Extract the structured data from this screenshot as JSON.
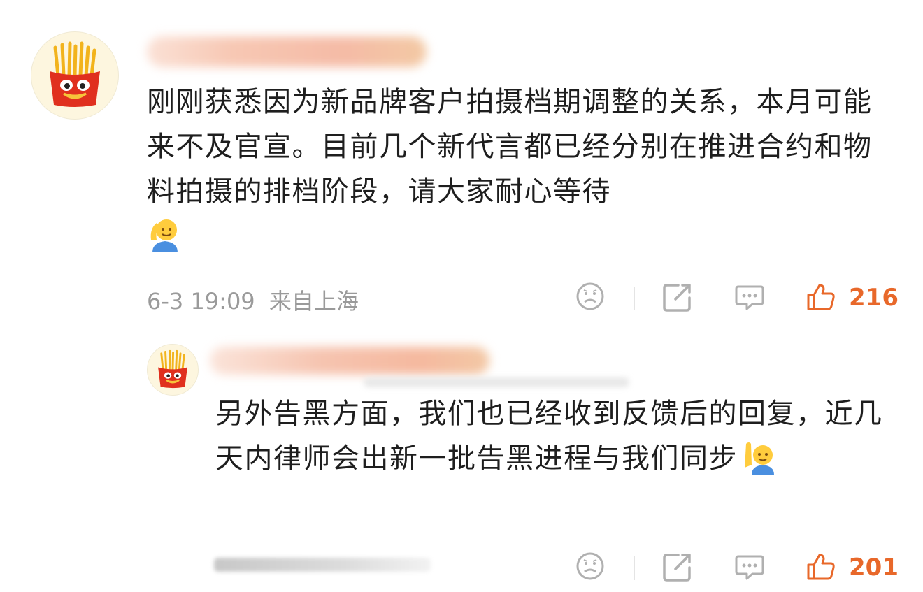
{
  "comment": {
    "author_name": "",
    "avatar_icon": "french-fries-icon",
    "text": "刚刚获悉因为新品牌客户拍摄档期调整的关系，本月可能来不及官宣。目前几个新代言都已经分别在推进合约和物料拍摄的排档阶段，请大家耐心等待",
    "emoji": "salute-emoji",
    "time": "6-3 19:09",
    "location": "来自上海",
    "likes": "216"
  },
  "reply": {
    "author_name": "",
    "avatar_icon": "french-fries-icon",
    "text": "另外告黑方面，我们也已经收到反馈后的回复，近几天内律师会出新一批告黑进程与我们同步",
    "emoji": "raise-hand-emoji",
    "likes": "201"
  },
  "colors": {
    "like": "#e8682a",
    "meta": "#9a9a9a",
    "icon": "#b0b0b0"
  }
}
